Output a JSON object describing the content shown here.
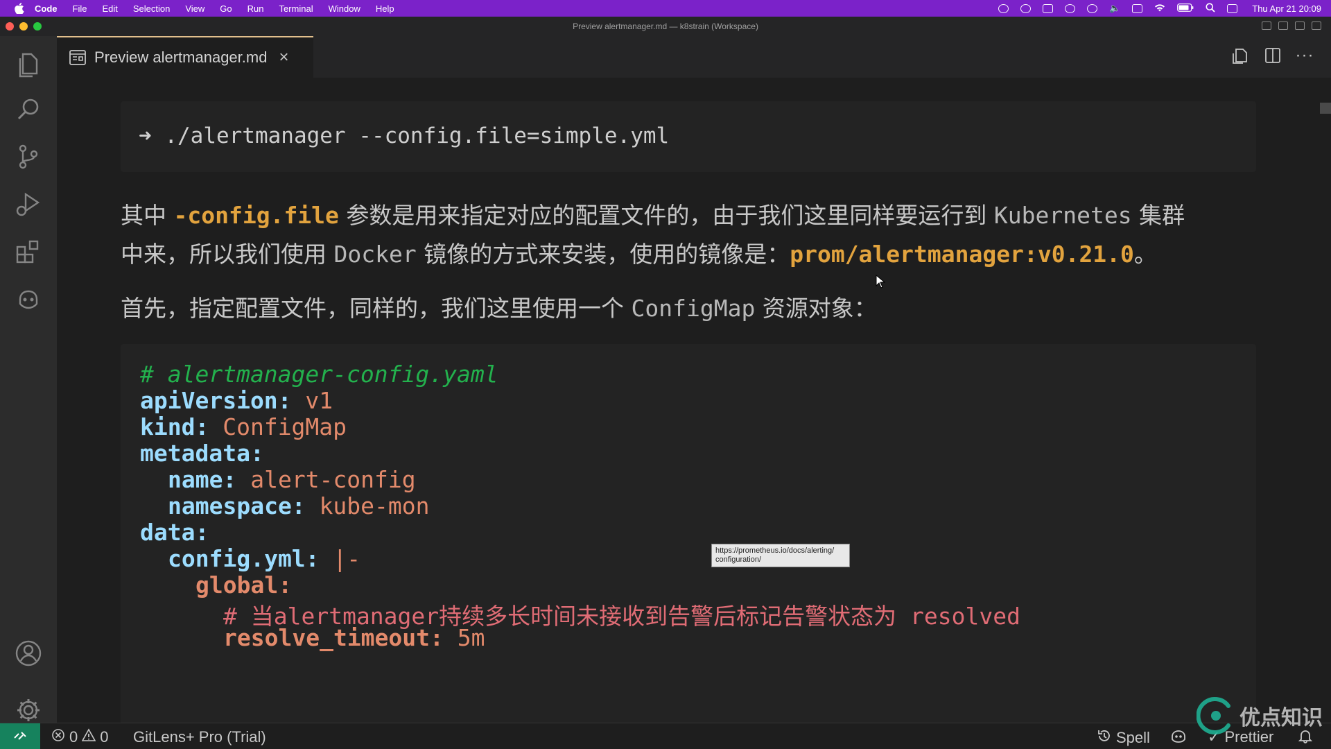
{
  "menubar": {
    "app": "Code",
    "items": [
      "File",
      "Edit",
      "Selection",
      "View",
      "Go",
      "Run",
      "Terminal",
      "Window",
      "Help"
    ],
    "clock": "Thu Apr 21  20:09"
  },
  "window": {
    "title": "Preview alertmanager.md — k8strain (Workspace)"
  },
  "tab": {
    "label": "Preview alertmanager.md"
  },
  "activity_icons": [
    "explorer-icon",
    "search-icon",
    "source-control-icon",
    "run-debug-icon",
    "extensions-icon",
    "copilot-icon",
    "accounts-icon",
    "settings-gear-icon"
  ],
  "content": {
    "command": "➜ ./alertmanager --config.file=simple.yml",
    "p1a_pre": "其中 ",
    "p1a_code": "-config.file",
    "p1a_mid": " 参数是用来指定对应的配置文件的，由于我们这里同样要运行到 ",
    "p1a_k8s": "Kubernetes",
    "p1a_end": " 集群",
    "p1b_pre": "中来，所以我们使用 ",
    "p1b_docker": "Docker",
    "p1b_mid": " 镜像的方式来安装，使用的镜像是：",
    "p1b_image": "prom/alertmanager:v0.21.0",
    "p1b_end": "。",
    "p2_pre": "首先，指定配置文件，同样的，我们这里使用一个 ",
    "p2_cm": "ConfigMap",
    "p2_end": " 资源对象："
  },
  "yaml": {
    "comment": "# alertmanager-config.yaml",
    "apiVersion_k": "apiVersion:",
    "apiVersion_v": "v1",
    "kind_k": "kind:",
    "kind_v": "ConfigMap",
    "metadata_k": "metadata:",
    "name_k": "name:",
    "name_v": "alert-config",
    "namespace_k": "namespace:",
    "namespace_v": "kube-mon",
    "data_k": "data:",
    "configyml_k": "config.yml:",
    "configyml_v": "|-",
    "global_k": "global:",
    "comment2": "# 当alertmanager持续多长时间未接收到告警后标记告警状态为 resolved",
    "resolve_k": "resolve_timeout:",
    "resolve_v": "5m"
  },
  "tooltip": {
    "line1": "https://prometheus.io/docs/alerting/",
    "line2": "configuration/"
  },
  "statusbar": {
    "errors": "0",
    "warnings": "0",
    "gitlens": "GitLens+ Pro (Trial)",
    "spell": "Spell",
    "prettier": "Prettier"
  },
  "watermark": {
    "text": "优点知识"
  },
  "colors": {
    "menubar": "#7b22c9",
    "tab_accent": "#e2c08d",
    "remote": "#16825d",
    "yaml_key": "#9cdcfe",
    "yaml_value": "#e38a6b",
    "yaml_comment": "#23b14d",
    "inline_code": "#e2a33e"
  }
}
